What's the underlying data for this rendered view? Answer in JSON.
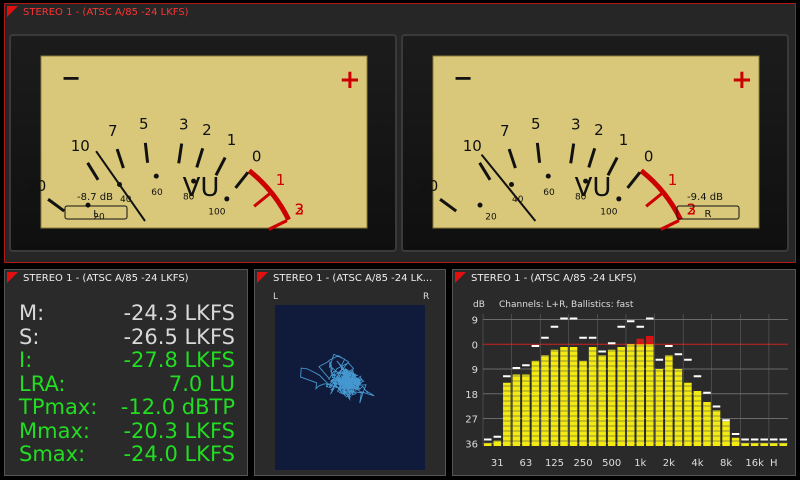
{
  "top_panel": {
    "title": "STEREO 1 - (ATSC A/85 -24 LKFS)"
  },
  "vu_meters": [
    {
      "channel": "L",
      "db_readout": "-8.7 dB",
      "value_db": -8.7,
      "minus_symbol": "−",
      "plus_symbol": "+",
      "brand": "VU"
    },
    {
      "channel": "R",
      "db_readout": "-9.4 dB",
      "value_db": -9.4,
      "minus_symbol": "−",
      "plus_symbol": "+",
      "brand": "VU"
    }
  ],
  "vu_scale": {
    "db_labels": [
      "20",
      "10",
      "7",
      "5",
      "3",
      "2",
      "1",
      "0",
      "1",
      "2",
      "3"
    ],
    "db_values": [
      -20,
      -10,
      -7,
      -5,
      -3,
      -2,
      -1,
      0,
      1,
      2,
      3
    ],
    "percent_labels": [
      "0",
      "20",
      "40",
      "60",
      "80",
      "100"
    ],
    "percent_values": [
      0,
      20,
      40,
      60,
      80,
      100
    ],
    "colors": {
      "face": "#d9c87a",
      "ink": "#111111",
      "red": "#cc0000"
    }
  },
  "loudness_panel": {
    "title": "STEREO 1 - (ATSC A/85 -24 LKFS)",
    "rows": [
      {
        "label": "M:",
        "value": "-24.3 LKFS",
        "color": "#d8d8d8"
      },
      {
        "label": "S:",
        "value": "-26.5 LKFS",
        "color": "#d8d8d8"
      },
      {
        "label": "I:",
        "value": "-27.8 LKFS",
        "color": "#22dd22"
      },
      {
        "label": "LRA:",
        "value": "7.0 LU",
        "color": "#22dd22"
      },
      {
        "label": "TPmax:",
        "value": "-12.0 dBTP",
        "color": "#22dd22"
      },
      {
        "label": "Mmax:",
        "value": "-20.3 LKFS",
        "color": "#22dd22"
      },
      {
        "label": "Smax:",
        "value": "-24.0 LKFS",
        "color": "#22dd22"
      }
    ]
  },
  "goniometer_panel": {
    "title": "STEREO 1 - (ATSC A/85 -24 LK...",
    "left_label": "L",
    "right_label": "R",
    "colors": {
      "background": "#101a3a",
      "trace": "#4aa6e0"
    }
  },
  "spectrum_panel": {
    "title": "STEREO 1 - (ATSC A/85 -24 LKFS)",
    "info": "Channels: L+R, Ballistics: fast",
    "y_unit": "dB",
    "y_ticks": [
      "9",
      "0",
      "9",
      "18",
      "27",
      "36"
    ],
    "y_tick_values": [
      9,
      0,
      -9,
      -18,
      -27,
      -36
    ],
    "x_ticks": [
      "31",
      "63",
      "125",
      "250",
      "500",
      "1k",
      "2k",
      "4k",
      "8k",
      "16k",
      "H"
    ],
    "x_tick_bands": [
      2,
      5,
      8,
      11,
      14,
      17,
      20,
      23,
      26,
      29,
      31
    ],
    "colors": {
      "bar": "#f2ea10",
      "overload": "#dd1111",
      "grid": "#6a6a6a",
      "zero_line": "#cc2222",
      "peak": "#ffffff"
    }
  },
  "chart_data": {
    "type": "bar",
    "title": "",
    "ylabel": "dB",
    "ylim": [
      -37,
      11
    ],
    "categories": [
      "b1",
      "b2",
      "b3",
      "b4",
      "b5",
      "b6",
      "b7",
      "b8",
      "b9",
      "b10",
      "b11",
      "b12",
      "b13",
      "b14",
      "b15",
      "b16",
      "b17",
      "b18",
      "b19",
      "b20",
      "b21",
      "b22",
      "b23",
      "b24",
      "b25",
      "b26",
      "b27",
      "b28",
      "b29",
      "b30",
      "b31"
    ],
    "values": [
      -36,
      -35,
      -14,
      -11,
      -11,
      -6,
      -4,
      -2,
      -1,
      -1,
      -6,
      -1,
      -4,
      -2,
      -1,
      0,
      2,
      3,
      -9,
      -4,
      -9,
      -14,
      -17,
      -21,
      -24,
      -28,
      -34,
      -36,
      -36,
      -36,
      -36,
      -36
    ],
    "peaks": [
      -35,
      -34,
      -12,
      -9,
      -8,
      -1,
      2,
      6,
      9,
      9,
      2,
      2,
      -3,
      0,
      6,
      8,
      6,
      9,
      -6,
      -1,
      -4,
      -6,
      -12,
      -18,
      -23,
      -28,
      -33,
      -35,
      -35,
      -35,
      -35,
      -35
    ]
  }
}
